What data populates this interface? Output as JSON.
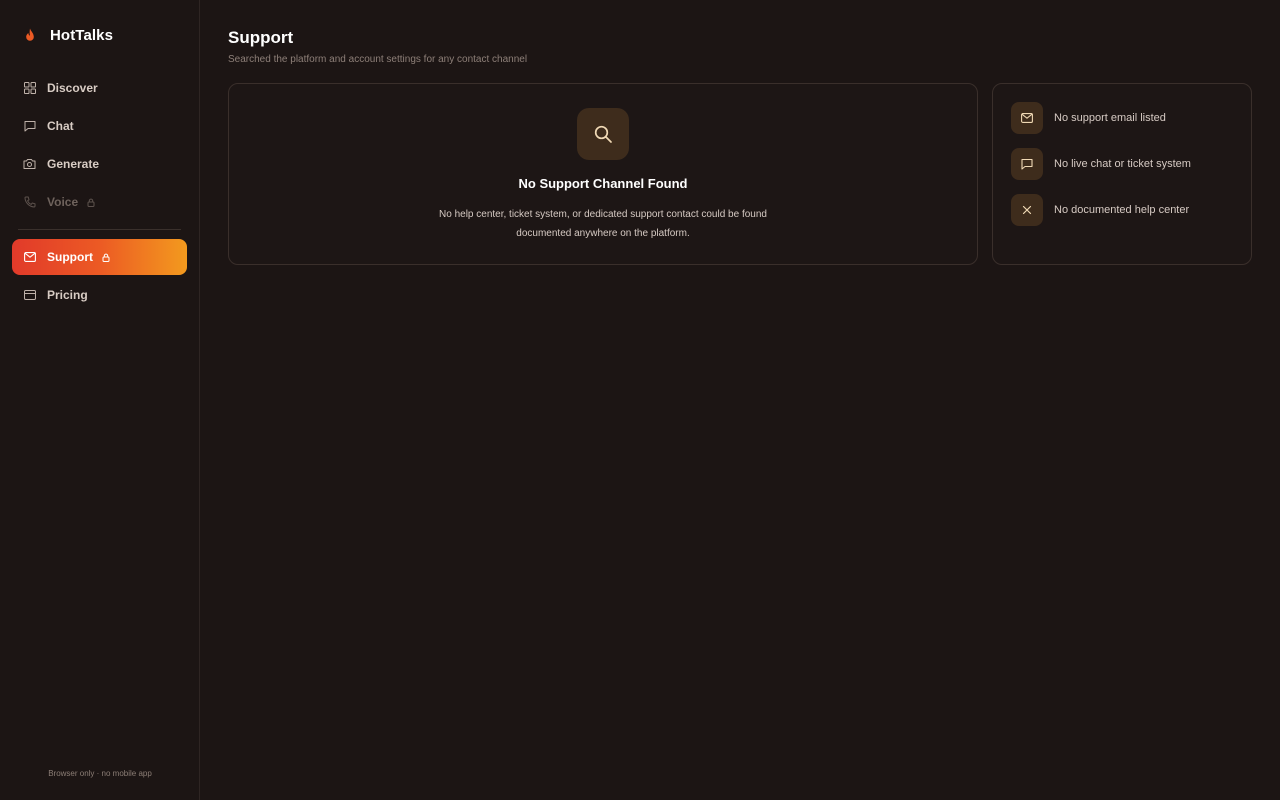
{
  "brand": {
    "name": "HotTalks",
    "logo_icon": "flame-icon",
    "accent": "#ec5a24"
  },
  "sidebar": {
    "items": [
      {
        "id": "discover",
        "label": "Discover",
        "icon": "grid-icon"
      },
      {
        "id": "chat",
        "label": "Chat",
        "icon": "chat-icon"
      },
      {
        "id": "generate",
        "label": "Generate",
        "icon": "camera-icon"
      },
      {
        "id": "voice",
        "label": "Voice",
        "icon": "phone-icon",
        "locked": true,
        "disabled": true
      },
      {
        "id": "support",
        "label": "Support",
        "icon": "mail-icon",
        "locked": true,
        "active": true
      },
      {
        "id": "pricing",
        "label": "Pricing",
        "icon": "card-icon"
      }
    ],
    "footer": "Browser only · no mobile app"
  },
  "page": {
    "title": "Support",
    "subtitle": "Searched the platform and account settings for any contact channel"
  },
  "empty_state": {
    "icon": "search-icon",
    "title": "No Support Channel Found",
    "description": "No help center, ticket system, or dedicated support contact could be found documented anywhere on the platform."
  },
  "findings": [
    {
      "icon": "mail-icon",
      "text": "No support email listed"
    },
    {
      "icon": "chat-icon",
      "text": "No live chat or ticket system"
    },
    {
      "icon": "close-icon",
      "text": "No documented help center"
    }
  ],
  "colors": {
    "background": "#1c1514",
    "active_gradient_start": "#e13a2a",
    "active_gradient_end": "#f39a1e",
    "icon_badge": "#3e2c1c",
    "icon_tint": "#f0d9b5"
  }
}
